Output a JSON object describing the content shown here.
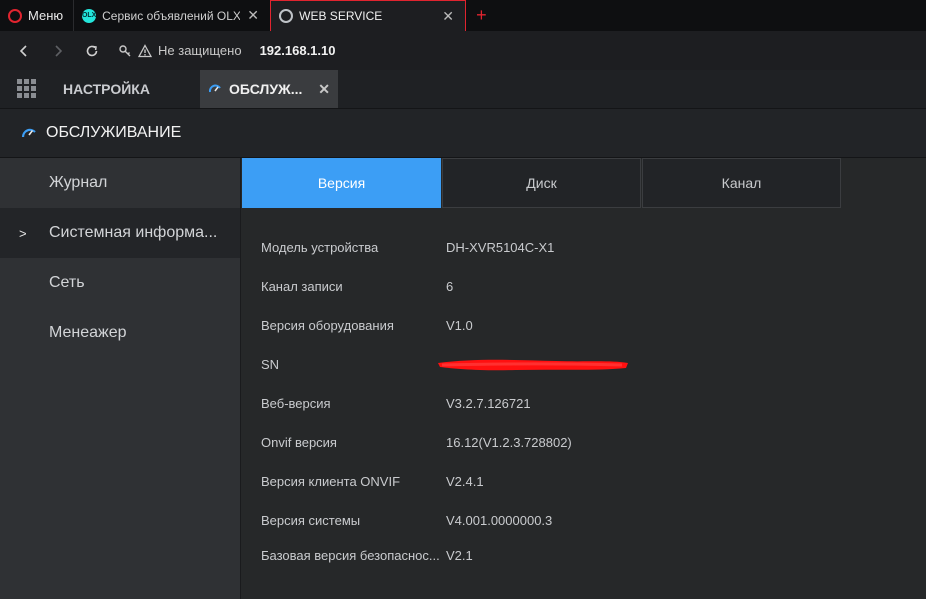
{
  "browser": {
    "menu_label": "Меню",
    "tabs": [
      {
        "title": "Сервис объявлений OLX: с",
        "favicon": "olx-icon"
      },
      {
        "title": "WEB SERVICE",
        "favicon": "web-icon"
      }
    ],
    "new_tab": "+",
    "security_text": "Не защищено",
    "url": "192.168.1.10"
  },
  "app": {
    "tab_setup": "НАСТРОЙКА",
    "tab_maintenance": "ОБСЛУЖ...",
    "page_title": "ОБСЛУЖИВАНИЕ"
  },
  "sidebar": {
    "items": [
      {
        "label": "Журнал",
        "active": false
      },
      {
        "label": "Системная информа...",
        "active": true
      },
      {
        "label": "Сеть",
        "active": false
      },
      {
        "label": "Менеажер",
        "active": false
      }
    ]
  },
  "subtabs": [
    {
      "label": "Версия",
      "active": true
    },
    {
      "label": "Диск",
      "active": false
    },
    {
      "label": "Канал",
      "active": false
    }
  ],
  "info": [
    {
      "key": "Модель устройства",
      "value": "DH-XVR5104C-X1"
    },
    {
      "key": "Канал записи",
      "value": "6"
    },
    {
      "key": "Версия оборудования",
      "value": "V1.0"
    },
    {
      "key": "SN",
      "value": ""
    },
    {
      "key": "Веб-версия",
      "value": "V3.2.7.126721"
    },
    {
      "key": "Onvif версия",
      "value": "16.12(V1.2.3.728802)"
    },
    {
      "key": "Версия клиента ONVIF",
      "value": "V2.4.1"
    },
    {
      "key": "Версия системы",
      "value": "V4.001.0000000.3"
    },
    {
      "key": "Базовая версия безопаснос...",
      "value": "V2.1"
    }
  ],
  "colors": {
    "accent": "#3c9ef5",
    "opera_red": "#e0242f",
    "redaction": "#ff0000"
  }
}
